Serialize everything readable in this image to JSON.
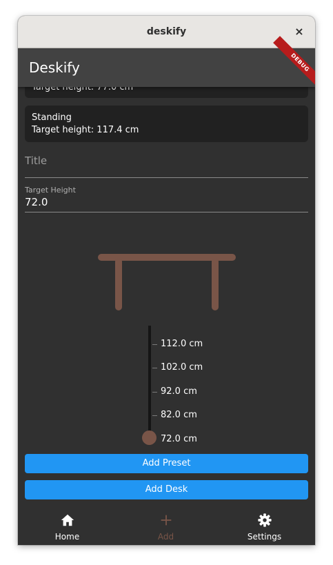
{
  "window": {
    "title": "deskify",
    "close_glyph": "×"
  },
  "appbar": {
    "title": "Deskify",
    "debug_banner": "DEBUG"
  },
  "presets": [
    {
      "name": "",
      "target_line": "Target height: 77.0 cm"
    },
    {
      "name": "Standing",
      "target_line": "Target height: 117.4 cm"
    }
  ],
  "form": {
    "title_placeholder": "Title",
    "target_height_label": "Target Height",
    "target_height_value": "72.0"
  },
  "desk_preview": {
    "color": "#795548"
  },
  "slider": {
    "current_value": 72.0,
    "ticks": [
      "112.0 cm",
      "102.0 cm",
      "92.0 cm",
      "82.0 cm",
      "72.0 cm"
    ],
    "thumb_color": "#795548"
  },
  "actions": {
    "add_preset_label": "Add Preset",
    "add_desk_label": "Add Desk",
    "color": "#2196f3"
  },
  "nav": {
    "items": [
      {
        "label": "Home",
        "icon": "home-icon",
        "active": false
      },
      {
        "label": "Add",
        "icon": "plus-icon",
        "active": true
      },
      {
        "label": "Settings",
        "icon": "gear-icon",
        "active": false
      }
    ],
    "active_color": "#795548"
  }
}
